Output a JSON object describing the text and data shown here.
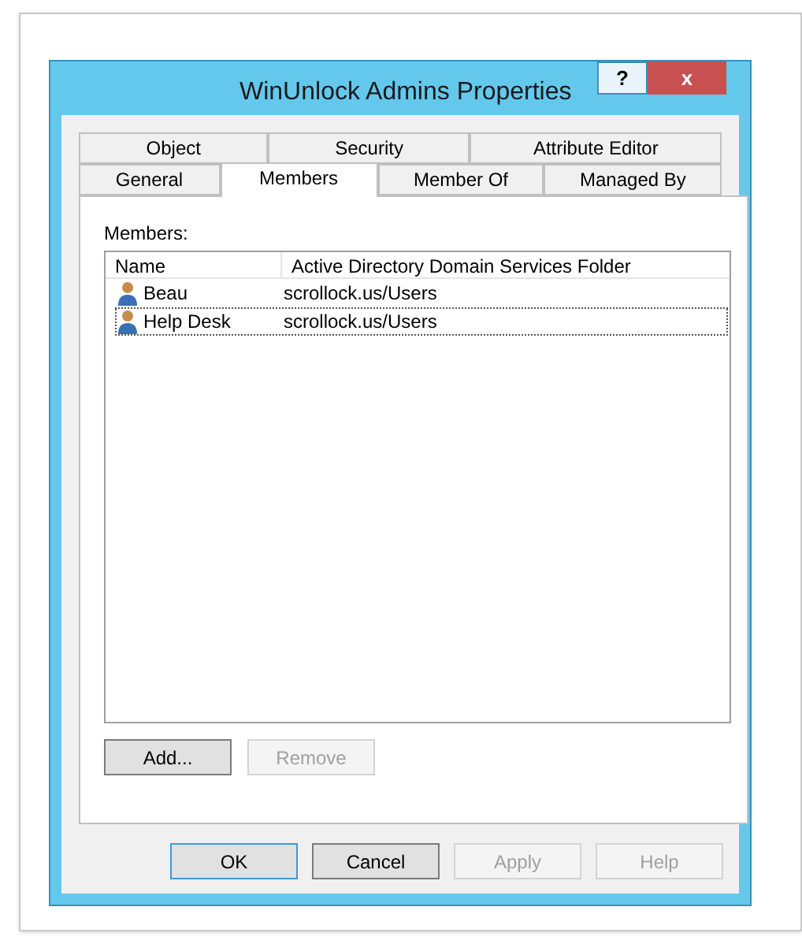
{
  "window": {
    "title": "WinUnlock Admins Properties",
    "help_button": "?",
    "close_button": "x"
  },
  "tab_rows": [
    [
      {
        "label": "Object",
        "selected": false
      },
      {
        "label": "Security",
        "selected": false
      },
      {
        "label": "Attribute Editor",
        "selected": false
      }
    ],
    [
      {
        "label": "General",
        "selected": false
      },
      {
        "label": "Members",
        "selected": true
      },
      {
        "label": "Member Of",
        "selected": false
      },
      {
        "label": "Managed By",
        "selected": false
      }
    ]
  ],
  "members": {
    "label": "Members:",
    "columns": [
      "Name",
      "Active Directory Domain Services Folder"
    ],
    "rows": [
      {
        "name": "Beau",
        "folder": "scrollock.us/Users",
        "focused": false
      },
      {
        "name": "Help Desk",
        "folder": "scrollock.us/Users",
        "focused": true
      }
    ]
  },
  "member_buttons": [
    {
      "label": "Add...",
      "disabled": false
    },
    {
      "label": "Remove",
      "disabled": true
    }
  ],
  "dialog_buttons": [
    {
      "label": "OK",
      "disabled": false,
      "default": true
    },
    {
      "label": "Cancel",
      "disabled": false,
      "default": false
    },
    {
      "label": "Apply",
      "disabled": true,
      "default": false
    },
    {
      "label": "Help",
      "disabled": true,
      "default": false
    }
  ]
}
